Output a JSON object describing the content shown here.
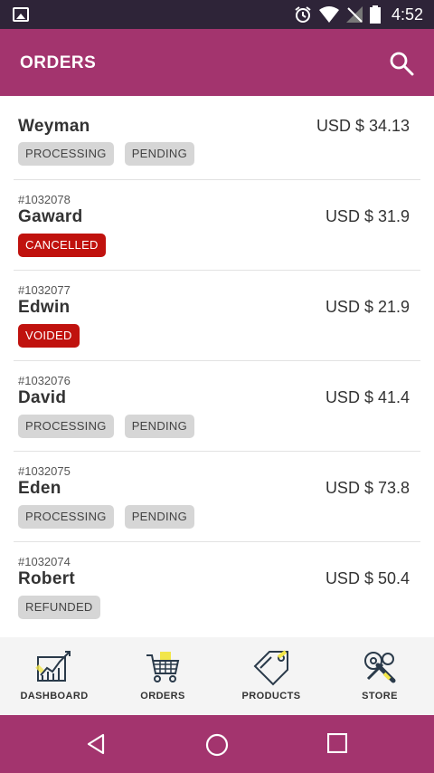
{
  "status_bar": {
    "time": "4:52"
  },
  "app_bar": {
    "title": "ORDERS"
  },
  "orders": [
    {
      "id": "",
      "name": "Weyman",
      "price": "USD $ 34.13",
      "badges": [
        {
          "label": "PROCESSING",
          "style": "gray"
        },
        {
          "label": "PENDING",
          "style": "gray"
        }
      ]
    },
    {
      "id": "#1032078",
      "name": "Gaward",
      "price": "USD $ 31.9",
      "badges": [
        {
          "label": "CANCELLED",
          "style": "red"
        }
      ]
    },
    {
      "id": "#1032077",
      "name": "Edwin",
      "price": "USD $ 21.9",
      "badges": [
        {
          "label": "VOIDED",
          "style": "red"
        }
      ]
    },
    {
      "id": "#1032076",
      "name": "David",
      "price": "USD $ 41.4",
      "badges": [
        {
          "label": "PROCESSING",
          "style": "gray"
        },
        {
          "label": "PENDING",
          "style": "gray"
        }
      ]
    },
    {
      "id": "#1032075",
      "name": "Eden",
      "price": "USD $ 73.8",
      "badges": [
        {
          "label": "PROCESSING",
          "style": "gray"
        },
        {
          "label": "PENDING",
          "style": "gray"
        }
      ]
    },
    {
      "id": "#1032074",
      "name": "Robert",
      "price": "USD $ 50.4",
      "badges": [
        {
          "label": "REFUNDED",
          "style": "gray"
        }
      ]
    }
  ],
  "bottom_nav": [
    {
      "label": "DASHBOARD",
      "icon": "dashboard-chart-icon"
    },
    {
      "label": "ORDERS",
      "icon": "shopping-cart-icon"
    },
    {
      "label": "PRODUCTS",
      "icon": "price-tag-icon"
    },
    {
      "label": "STORE",
      "icon": "tools-icon"
    }
  ],
  "colors": {
    "accent": "#a3346e",
    "status_bar": "#2e2438",
    "badge_red": "#c0120e",
    "badge_gray": "#d6d6d6"
  }
}
